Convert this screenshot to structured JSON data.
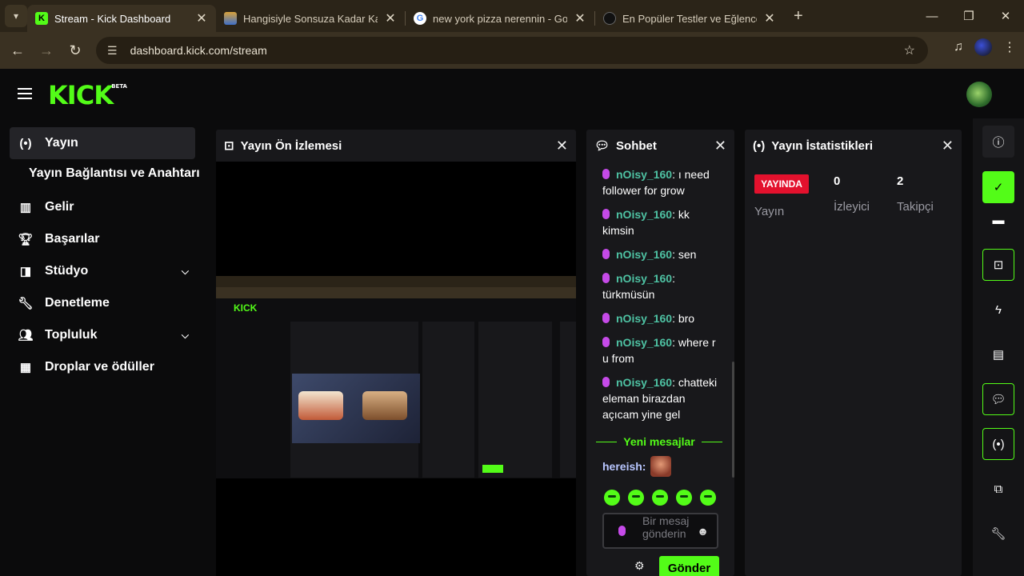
{
  "browser": {
    "tabs": [
      {
        "title": "Stream - Kick Dashboard",
        "active": true,
        "icon": "kick-favicon"
      },
      {
        "title": "Hangisiyle Sonsuza Kadar Kahv",
        "active": false,
        "icon": "image-favicon"
      },
      {
        "title": "new york pizza nerennin - Goog",
        "active": false,
        "icon": "google-favicon"
      },
      {
        "title": "En Popüler Testler ve Eğlenceli",
        "active": false,
        "icon": "site-favicon"
      }
    ],
    "url": "dashboard.kick.com/stream"
  },
  "header": {
    "logo": "KICK",
    "beta": "BETA"
  },
  "sidebar": {
    "items": [
      {
        "label": "Yayın",
        "icon": "broadcast-icon"
      },
      {
        "label": "Yayın Bağlantısı ve Anahtarı"
      },
      {
        "label": "Gelir",
        "icon": "chart-icon"
      },
      {
        "label": "Başarılar",
        "icon": "trophy-icon"
      },
      {
        "label": "Stüdyo",
        "icon": "studio-icon"
      },
      {
        "label": "Denetleme",
        "icon": "wrench-icon"
      },
      {
        "label": "Topluluk",
        "icon": "community-icon"
      },
      {
        "label": "Droplar ve ödüller",
        "icon": "gift-icon"
      }
    ]
  },
  "preview": {
    "title": "Yayın Ön İzlemesi"
  },
  "chat": {
    "title": "Sohbet",
    "messages": [
      {
        "user": "nOisy_160",
        "text": "ı need follower for grow"
      },
      {
        "user": "nOisy_160",
        "text": "kk kimsin"
      },
      {
        "user": "nOisy_160",
        "text": "sen"
      },
      {
        "user": "nOisy_160",
        "text": "türkmüsün"
      },
      {
        "user": "nOisy_160",
        "text": "bro"
      },
      {
        "user": "nOisy_160",
        "text": "where r u from"
      },
      {
        "user": "nOisy_160",
        "text": "chatteki eleman birazdan açıcam yine gel"
      }
    ],
    "new_messages": "Yeni mesajlar",
    "latest_user": "hereish:",
    "placeholder": "Bir mesaj gönderin",
    "send": "Gönder"
  },
  "stats": {
    "title": "Yayın İstatistikleri",
    "live_badge": "YAYINDA",
    "stream_label": "Yayın",
    "viewers_value": "0",
    "viewers_label": "İzleyici",
    "followers_value": "2",
    "followers_label": "Takipçi"
  },
  "colors": {
    "accent": "#53fc18",
    "live": "#e3112d",
    "username": "#4ec2a3"
  }
}
